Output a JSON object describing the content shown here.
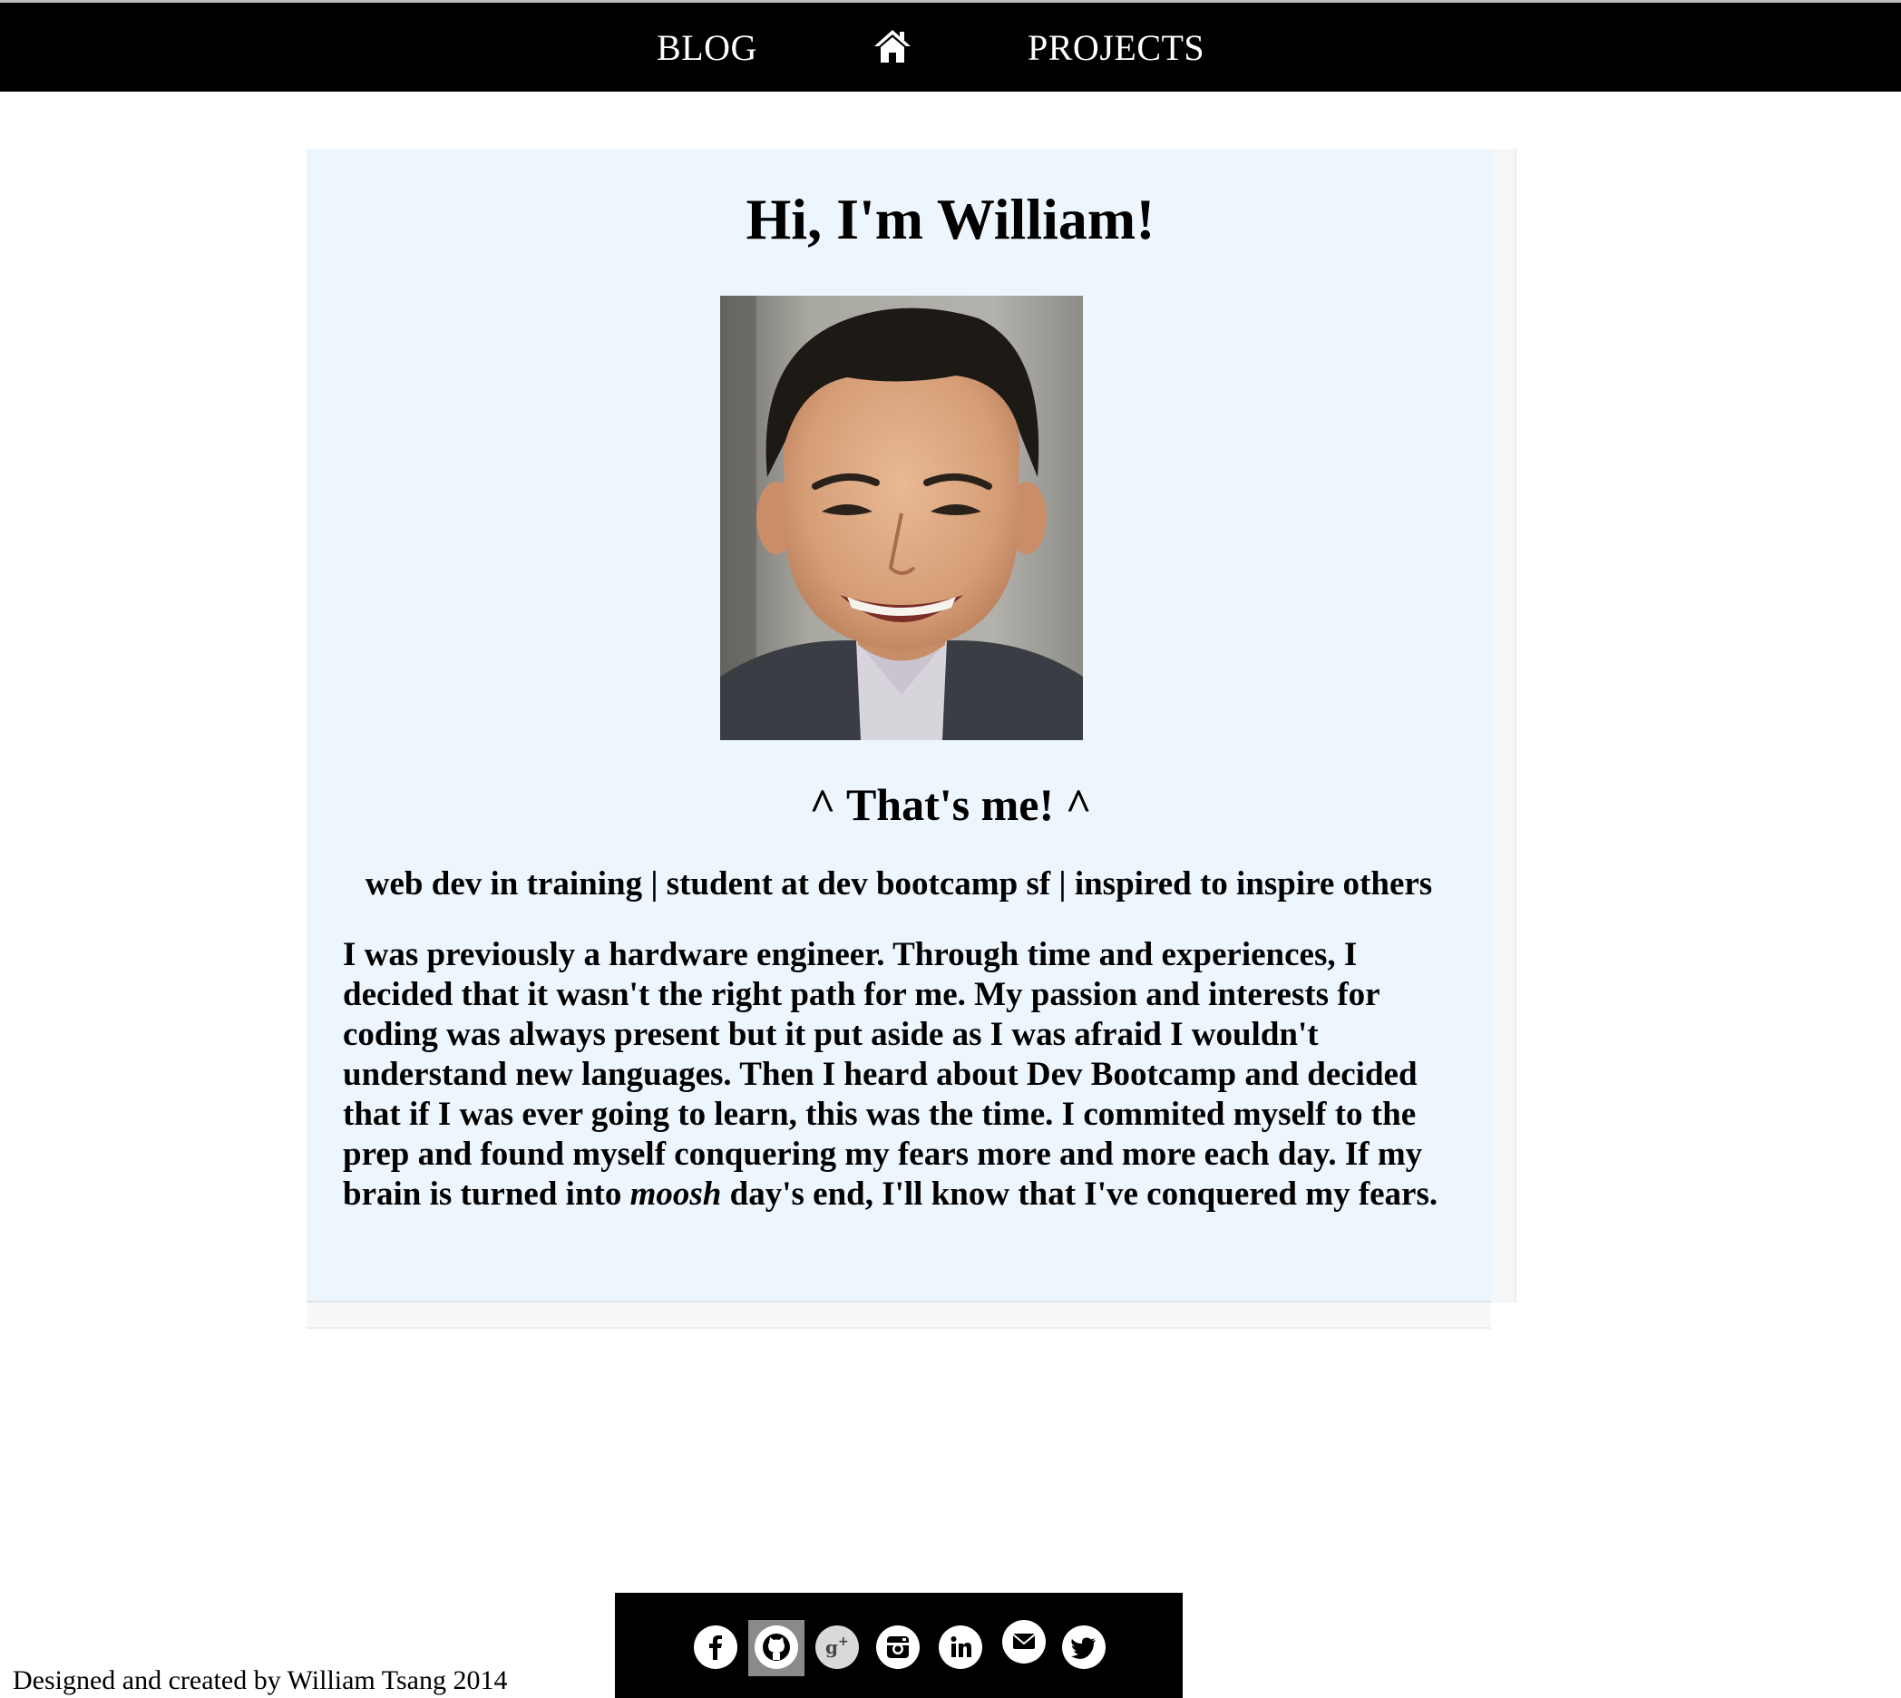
{
  "nav": {
    "blog_label": "BLOG",
    "home_icon": "home-icon",
    "projects_label": "PROJECTS"
  },
  "card": {
    "title": "Hi, I'm William!",
    "caption": "^ That's me! ^",
    "tagline": "web dev in training | student at dev bootcamp sf | inspired to inspire others",
    "bio_before": "I was previously a hardware engineer. Through time and experiences, I decided that it wasn't the right path for me. My passion and interests for coding was always present but it put aside as I was afraid I wouldn't understand new languages. Then I heard about Dev Bootcamp and decided that if I was ever going to learn, this was the time. I commited myself to the prep and found myself conquering my fears more and more each day. If my brain is turned into ",
    "bio_emphasis": "moosh",
    "bio_after": " day's end, I'll know that I've conquered my fears."
  },
  "footer": {
    "credits": "Designed and created by William Tsang 2014",
    "social_icons": [
      "facebook-icon",
      "github-icon",
      "google-plus-icon",
      "instagram-icon",
      "linkedin-icon",
      "email-icon",
      "twitter-icon"
    ]
  },
  "colors": {
    "nav_background": "#000000",
    "card_background": "#eef6fd"
  }
}
